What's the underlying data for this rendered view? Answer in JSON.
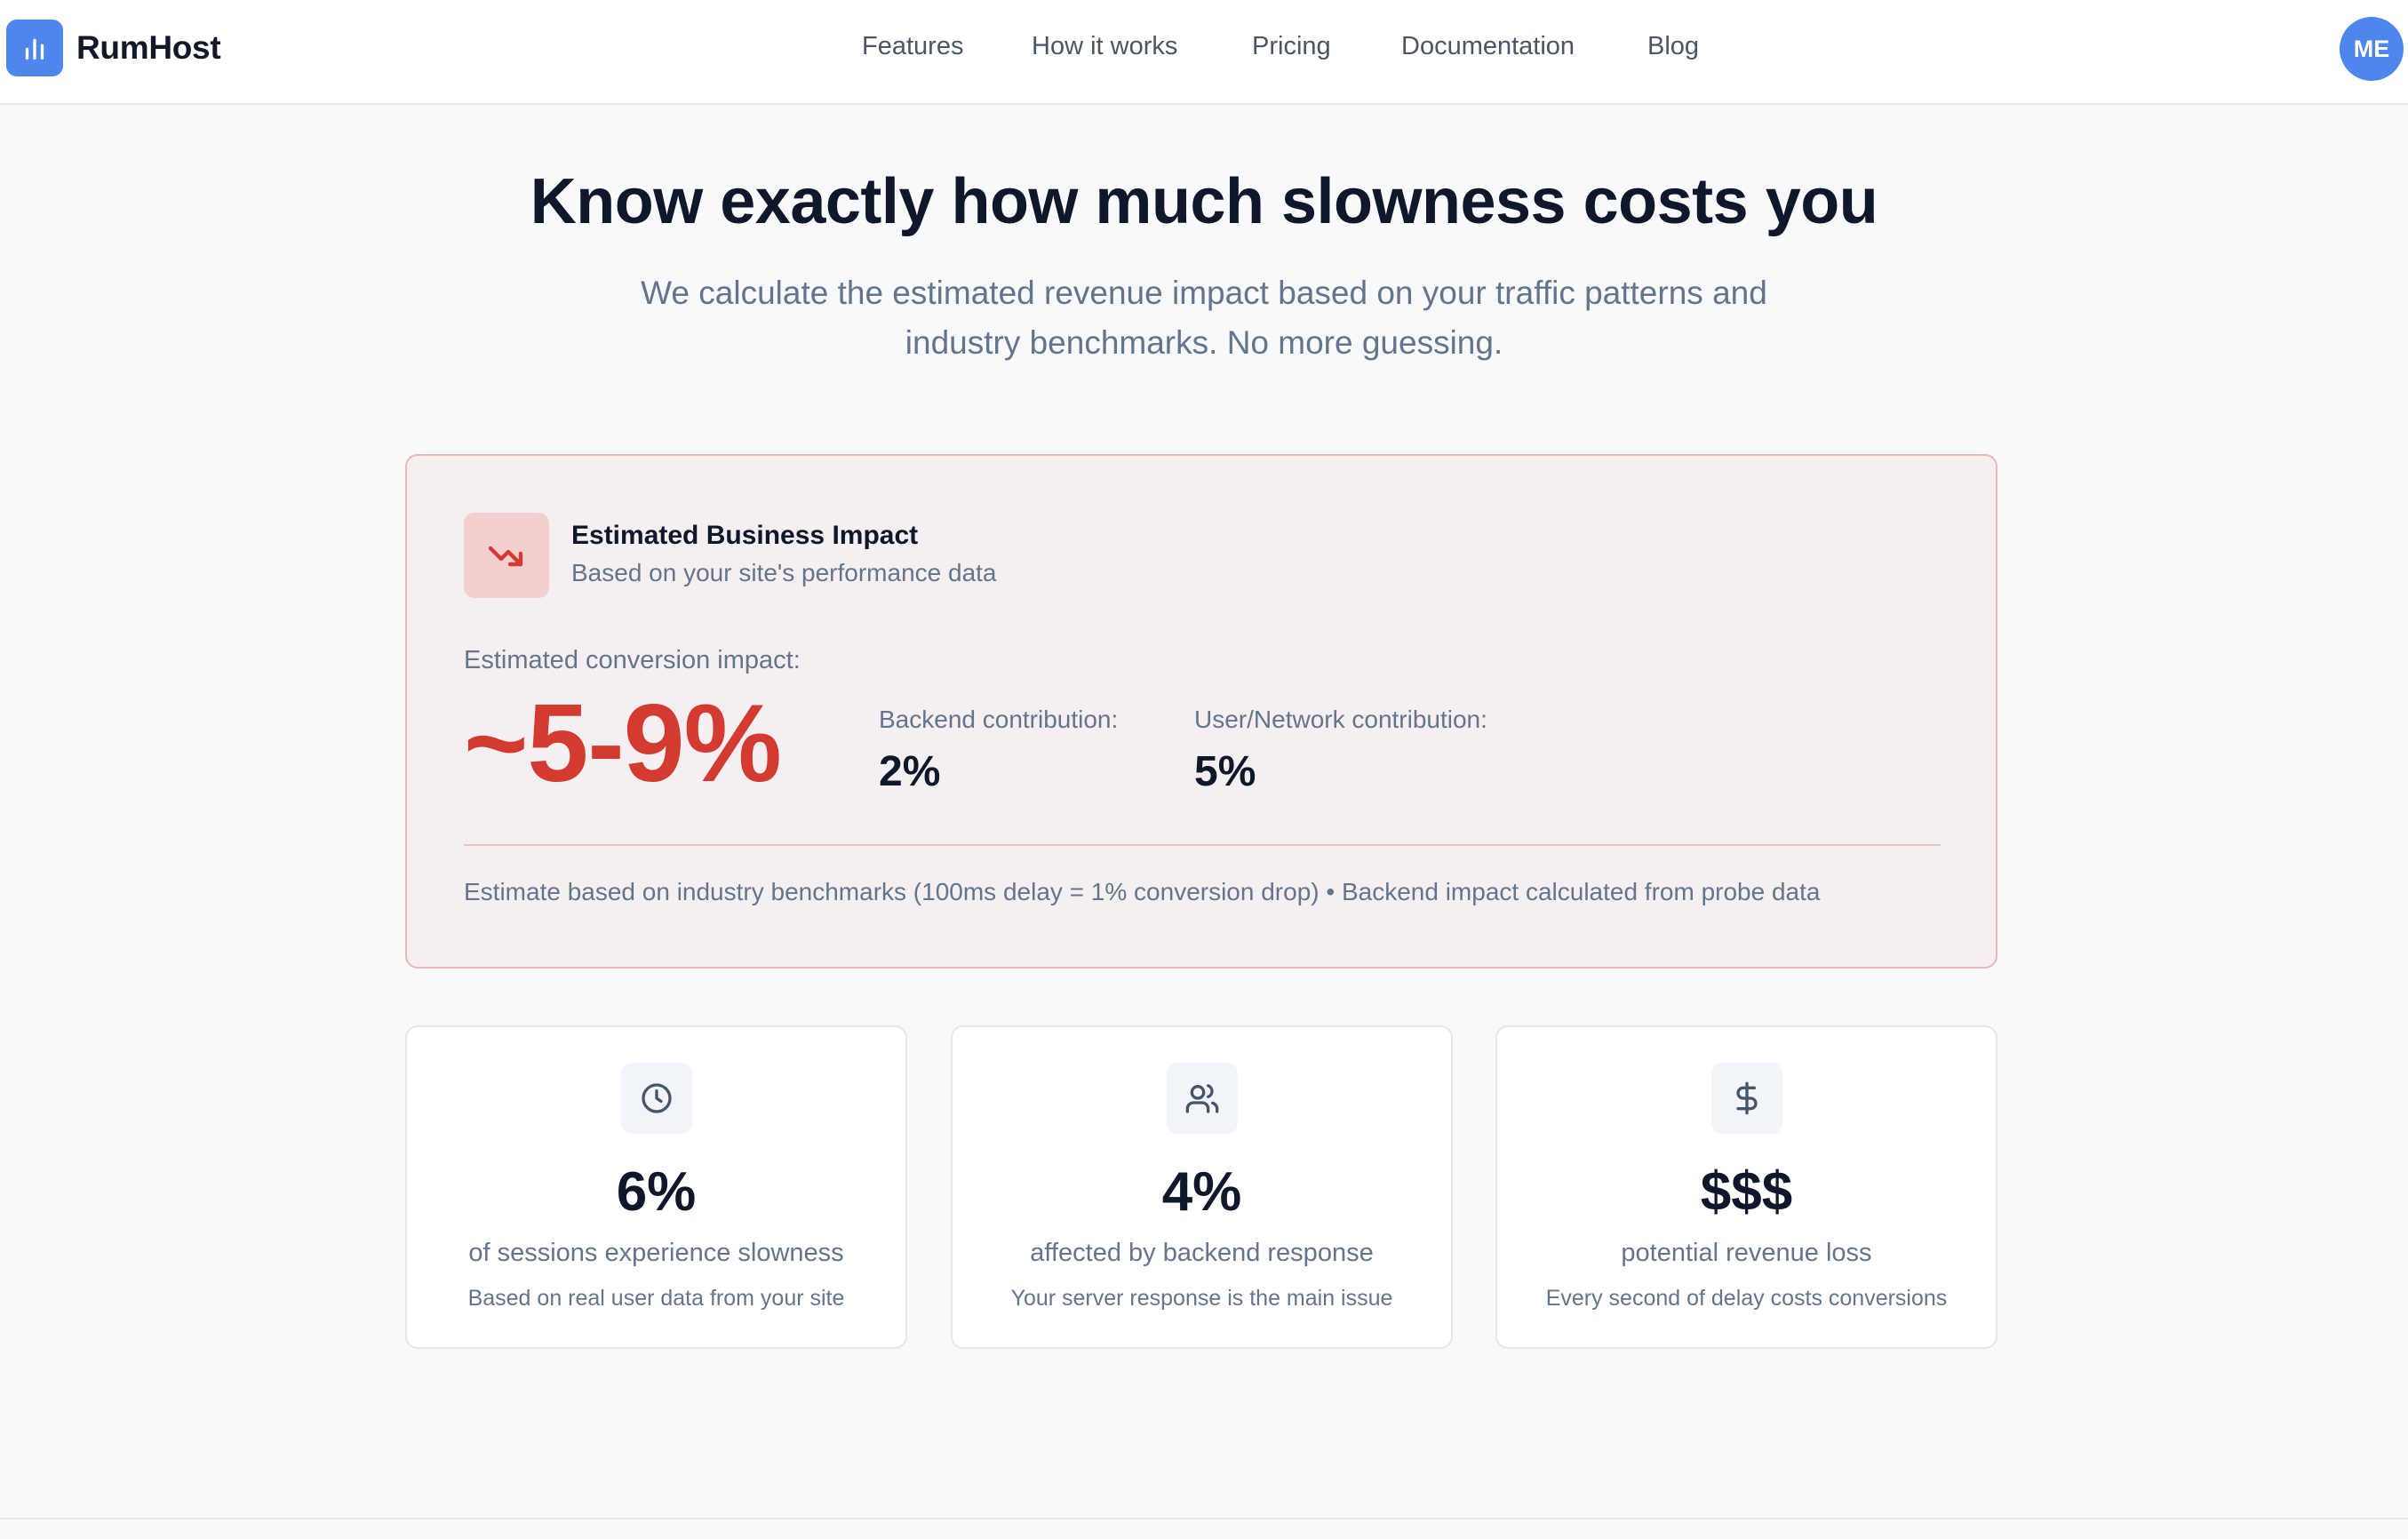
{
  "nav": {
    "brand": "RumHost",
    "links": [
      "Features",
      "How it works",
      "Pricing",
      "Documentation",
      "Blog"
    ],
    "avatar_initials": "ME"
  },
  "hero": {
    "title": "Know exactly how much slowness costs you",
    "subtitle_line1": "We calculate the estimated revenue impact based on your traffic patterns and",
    "subtitle_line2": "industry benchmarks. No more guessing."
  },
  "impact": {
    "icon": "trending-down-icon",
    "title": "Estimated Business Impact",
    "subtitle": "Based on your site's performance data",
    "conversion_label": "Estimated conversion impact:",
    "conversion_value": "~5-9%",
    "backend_label": "Backend contribution:",
    "backend_value": "2%",
    "network_label": "User/Network contribution:",
    "network_value": "5%",
    "note": "Estimate based on industry benchmarks (100ms delay = 1% conversion drop) • Backend impact calculated from probe data",
    "accent_color": "#d33a30"
  },
  "stats": [
    {
      "icon": "clock-icon",
      "value": "6%",
      "label": "of sessions experience slowness",
      "desc": "Based on real user data from your site"
    },
    {
      "icon": "users-icon",
      "value": "4%",
      "label": "affected by backend response",
      "desc": "Your server response is the main issue"
    },
    {
      "icon": "dollar-icon",
      "value": "$$$",
      "label": "potential revenue loss",
      "desc": "Every second of delay costs conversions"
    }
  ],
  "colors": {
    "brand": "#4f86ee",
    "text": "#0f172a",
    "muted": "#64748b"
  }
}
